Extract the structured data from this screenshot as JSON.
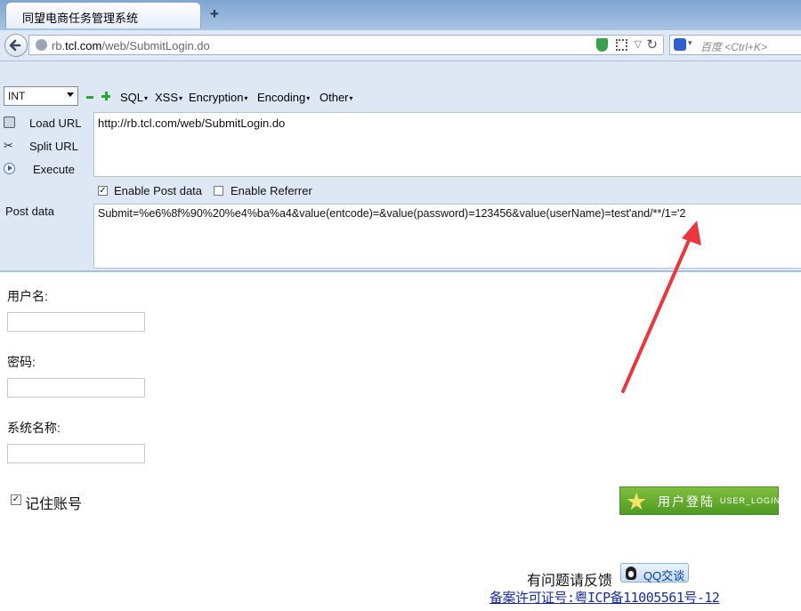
{
  "browser": {
    "tab_title": "同望电商任务管理系统",
    "new_tab_symbol": "+",
    "url_prefix": "rb.",
    "url_domain": "tcl.com",
    "url_path": "/web/SubmitLogin.do",
    "search_placeholder": "百度 <Ctrl+K>"
  },
  "hackbar": {
    "type_select": "INT",
    "menus": [
      "SQL",
      "XSS",
      "Encryption",
      "Encoding",
      "Other"
    ],
    "side_items": [
      "Load URL",
      "Split URL",
      "Execute"
    ],
    "url_value": "http://rb.tcl.com/web/SubmitLogin.do",
    "enable_post_label": "Enable Post data",
    "enable_post_checked": true,
    "enable_referrer_label": "Enable Referrer",
    "enable_referrer_checked": false,
    "post_label": "Post data",
    "post_value": "Submit=%e6%8f%90%20%e4%ba%a4&value(entcode)=&value(password)=123456&value(userName)=test'and/**/1='2"
  },
  "form": {
    "username_label": "用户名:",
    "password_label": "密码:",
    "system_label": "系统名称:",
    "remember_label": "记住账号",
    "remember_checked": true,
    "login_button_cn": "用户登陆",
    "login_button_en": "USER_LOGIN"
  },
  "footer": {
    "feedback_text": "有问题请反馈",
    "qq_label": "QQ交谈",
    "icp_text": "备案许可证号:粤ICP备11005561号-12"
  },
  "colors": {
    "annotation_arrow": "#e8383d",
    "login_green": "#5aa52a"
  }
}
